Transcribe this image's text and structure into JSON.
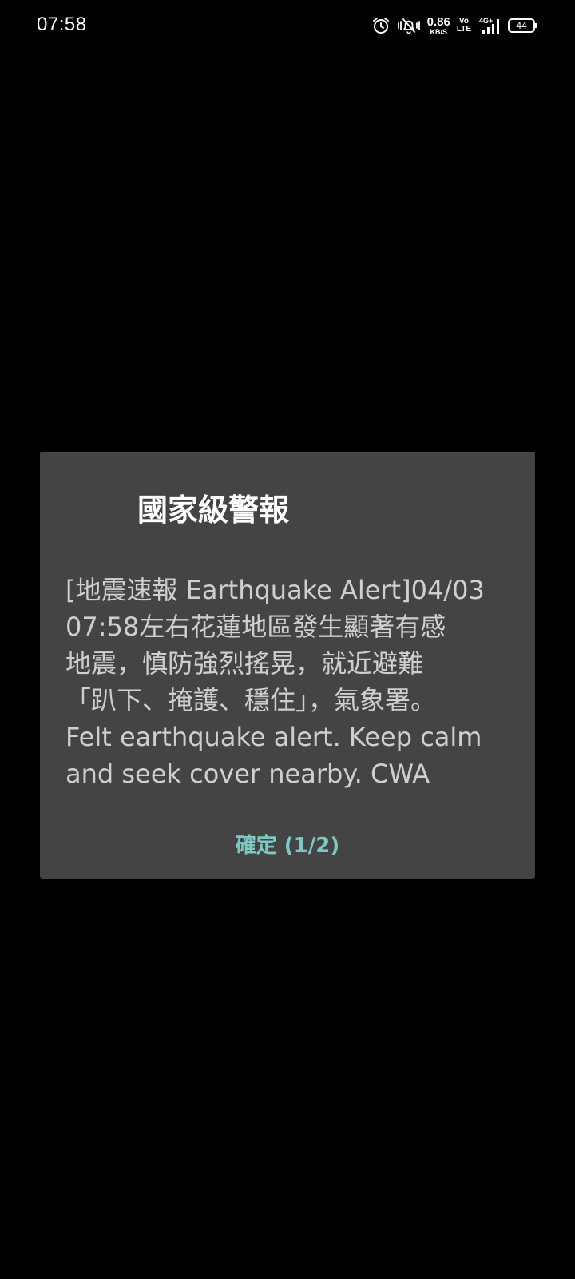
{
  "status_bar": {
    "time": "07:58",
    "net_speed_value": "0.86",
    "net_speed_unit": "KB/S",
    "volte_top": "Vo",
    "volte_bottom": "LTE",
    "network_type": "4G+",
    "battery_level": "44",
    "icons": [
      "alarm-icon",
      "vibrate-silent-icon",
      "signal-icon"
    ]
  },
  "alert_dialog": {
    "title": "國家級警報",
    "message": "[地震速報 Earthquake Alert]04/03\n07:58左右花蓮地區發生顯著有感\n地震，慎防強烈搖晃，就近避難\n「趴下、掩護、穩住」，氣象署。\nFelt earthquake alert. Keep calm\nand seek cover nearby. CWA",
    "confirm_label": "確定 (1/2)"
  },
  "colors": {
    "background": "#000000",
    "dialog_background": "#444444",
    "title_text": "#ffffff",
    "message_text": "#cfcfcf",
    "accent": "#7ec8c4"
  }
}
